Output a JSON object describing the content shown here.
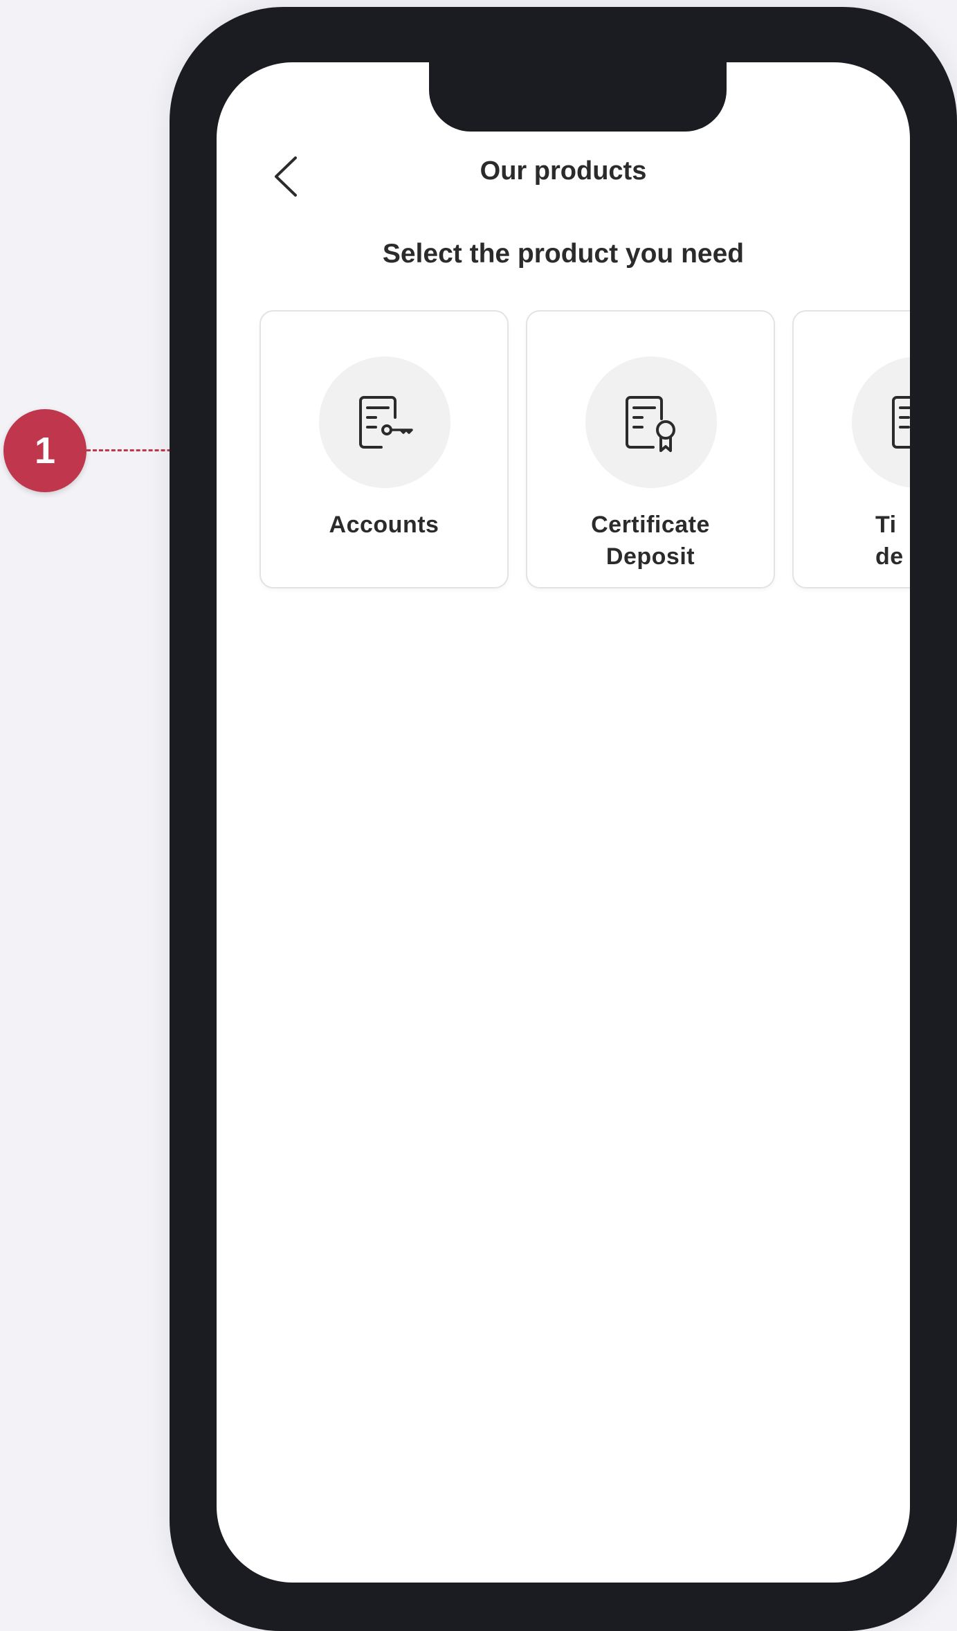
{
  "annotation": {
    "marker_number": "1",
    "marker_color": "#c0364d"
  },
  "header": {
    "title": "Our products",
    "back_icon": "chevron-left-icon"
  },
  "main": {
    "subtitle": "Select the product you need",
    "products": [
      {
        "label_line1": "Accounts",
        "label_line2": "",
        "icon": "document-key-icon"
      },
      {
        "label_line1": "Certificate",
        "label_line2": "Deposit",
        "icon": "document-ribbon-icon"
      },
      {
        "label_line1": "Ti",
        "label_line2": "de",
        "icon": "document-icon"
      }
    ]
  },
  "colors": {
    "text_primary": "#2b2b2b",
    "phone_frame": "#1b1c22",
    "card_border": "#e3e3e3",
    "icon_circle": "#f1f1f1"
  }
}
